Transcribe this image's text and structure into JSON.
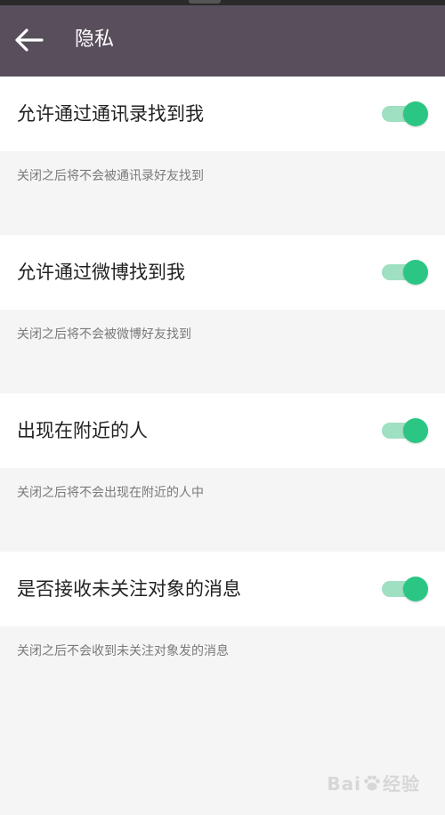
{
  "header": {
    "title": "隐私",
    "back_icon": "arrow-left-icon"
  },
  "colors": {
    "app_bar": "#594e5c",
    "toggle_on": "#2bc684",
    "toggle_track": "#9fdfc2"
  },
  "settings": [
    {
      "label": "允许通过通讯录找到我",
      "hint": "关闭之后将不会被通讯录好友找到",
      "enabled": true
    },
    {
      "label": "允许通过微博找到我",
      "hint": "关闭之后将不会被微博好友找到",
      "enabled": true
    },
    {
      "label": "出现在附近的人",
      "hint": "关闭之后将不会出现在附近的人中",
      "enabled": true
    },
    {
      "label": "是否接收未关注对象的消息",
      "hint": "关闭之后不会收到未关注对象发的消息",
      "enabled": true
    }
  ],
  "watermark": {
    "text_before": "Bai",
    "text_after": "经验"
  }
}
